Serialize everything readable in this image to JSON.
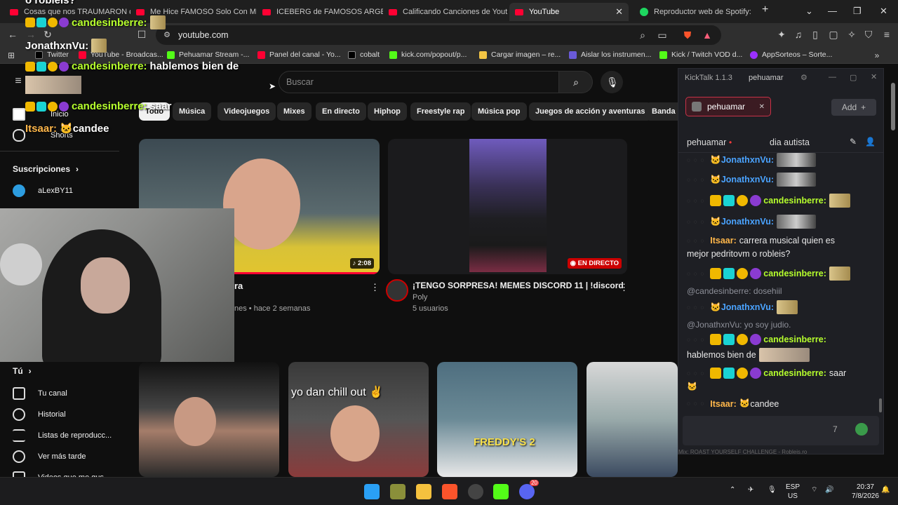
{
  "browser": {
    "tabs": [
      {
        "title": "Cosas que nos TRAUMARON de"
      },
      {
        "title": "Me Hice FAMOSO Solo Con ME"
      },
      {
        "title": "ICEBERG de FAMOSOS ARGEN"
      },
      {
        "title": "Calificando Canciones de Yout"
      },
      {
        "title": "YouTube",
        "active": true
      },
      {
        "title": "Reproductor web de Spotify: m"
      }
    ],
    "url": "youtube.com",
    "bookmarks": [
      "Twitter",
      "YouTube - Broadcas...",
      "Pehuamar Stream -...",
      "Panel del canal - Yo...",
      "cobalt",
      "kick.com/popout/p...",
      "Cargar imagen – re...",
      "Aislar los instrumen...",
      "Kick / Twitch VOD d...",
      "AppSorteos – Sorte..."
    ]
  },
  "youtube": {
    "search_placeholder": "Buscar",
    "chips": [
      "Todo",
      "Música",
      "Videojuegos",
      "Mixes",
      "En directo",
      "Hiphop",
      "Freestyle rap",
      "Música pop",
      "Juegos de acción y aventuras",
      "Banda s"
    ],
    "sidebar": {
      "home": "Inicio",
      "shorts": "Shorts",
      "subscriptions_heading": "Suscripciones",
      "subscriptions": [
        "aLexBY11"
      ],
      "you_heading": "Tú",
      "you_items": [
        "Tu canal",
        "Historial",
        "Listas de reproducc...",
        "Ver más tarde",
        "Videos que me gus..."
      ]
    },
    "videos": [
      {
        "title_partial": "ra",
        "meta_partial": "nes • hace 2 semanas",
        "duration": "2:08"
      },
      {
        "title": "¡TENGO SORPRESA! MEMES DISCORD 11 | !discord",
        "channel": "Poly",
        "meta": "5 usuarios",
        "badge": "EN DIRECTO"
      }
    ],
    "shorts_row": [
      {
        "caption": ""
      },
      {
        "caption": "yo dan chill out"
      },
      {
        "caption": "FREDDY'S 2"
      },
      {
        "caption": ""
      }
    ]
  },
  "overlay_chat": {
    "lines": [
      {
        "user": "",
        "text": "o robleis?"
      },
      {
        "user": "candesinberre:",
        "text": ""
      },
      {
        "user": "JonathxnVu:",
        "text": ""
      },
      {
        "user": "candesinberre:",
        "text": "hablemos bien de"
      },
      {
        "user": "candesinberre:",
        "text": "saar"
      },
      {
        "user": "Itsaar:",
        "text": "candee"
      }
    ]
  },
  "kicktalk": {
    "title": "KickTalk 1.1.3",
    "account": "pehuamar",
    "channel_tab": "pehuamar",
    "add_label": "Add",
    "stream_user": "pehuamar",
    "stream_title": "dia autista",
    "messages": [
      {
        "user": "JonathxnVu:",
        "text": "",
        "type": "jon"
      },
      {
        "user": "JonathxnVu:",
        "text": "",
        "type": "jon"
      },
      {
        "user": "candesinberre:",
        "text": "",
        "type": "cand"
      },
      {
        "user": "JonathxnVu:",
        "text": "",
        "type": "jon"
      },
      {
        "user": "Itsaar:",
        "text": "carrera musical quien es",
        "text2": "mejor pedritovm o robleis?",
        "type": "its"
      },
      {
        "user": "candesinberre:",
        "text": "",
        "type": "cand"
      },
      {
        "user": "JonathxnVu:",
        "text": "",
        "type": "jon"
      },
      {
        "user": "candesinberre:",
        "text": "hablemos bien de",
        "type": "cand"
      },
      {
        "user": "candesinberre:",
        "text": "saar",
        "type": "cand"
      },
      {
        "user": "Itsaar:",
        "text": "candee",
        "type": "its"
      }
    ],
    "replies": [
      {
        "text": "@candesinberre: dosehiil"
      },
      {
        "text": "@JonathxnVu: yo soy judio."
      }
    ],
    "footer_partial": "Mix: ROAST YOURSELF CHALLENGE - Robleis.ro"
  },
  "taskbar": {
    "lang": "ESP",
    "region": "US",
    "time": "20:37",
    "date": "7/8/2026",
    "discord_badge": "20"
  },
  "colors": {
    "youtube_red": "#ff0033",
    "kick_green": "#53fc18",
    "cand_name": "#b6ff2d",
    "jon_name": "#4aa3ff",
    "its_name": "#ffb74a"
  }
}
